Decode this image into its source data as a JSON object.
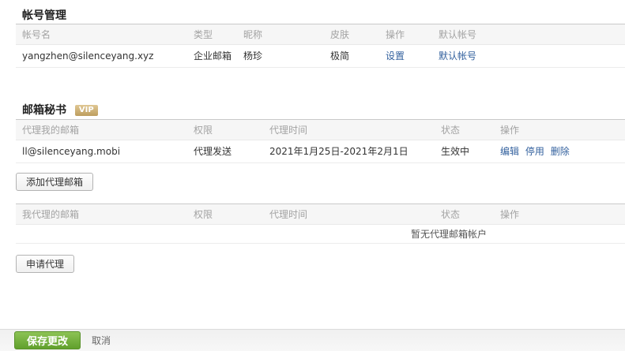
{
  "colors": {
    "link_blue": "#33619e",
    "vip_gold": "#bd9d5e",
    "save_green": "#61a02c",
    "header_text_gray": "#a3a3a3"
  },
  "account_section": {
    "title": "帐号管理",
    "headers": [
      "帐号名",
      "类型",
      "昵称",
      "皮肤",
      "操作",
      "默认帐号"
    ],
    "row": {
      "account": "yangzhen@silenceyang.xyz",
      "type": "企业邮箱",
      "nickname": "杨珍",
      "skin": "极简",
      "action_settings": "设置",
      "default_link": "默认帐号"
    }
  },
  "secretary_section": {
    "title": "邮箱秘书",
    "vip_badge": "VIP",
    "delegated_to_me": {
      "headers": [
        "代理我的邮箱",
        "权限",
        "代理时间",
        "状态",
        "操作"
      ],
      "row": {
        "email": "ll@silenceyang.mobi",
        "permission": "代理发送",
        "period": "2021年1月25日-2021年2月1日",
        "status": "生效中",
        "actions": [
          "编辑",
          "停用",
          "删除"
        ]
      },
      "add_button": "添加代理邮箱"
    },
    "delegated_by_me": {
      "headers": [
        "我代理的邮箱",
        "权限",
        "代理时间",
        "状态",
        "操作"
      ],
      "empty_text": "暂无代理邮箱帐户",
      "apply_button": "申请代理"
    }
  },
  "footer": {
    "save_label": "保存更改",
    "cancel_label": "取消"
  }
}
